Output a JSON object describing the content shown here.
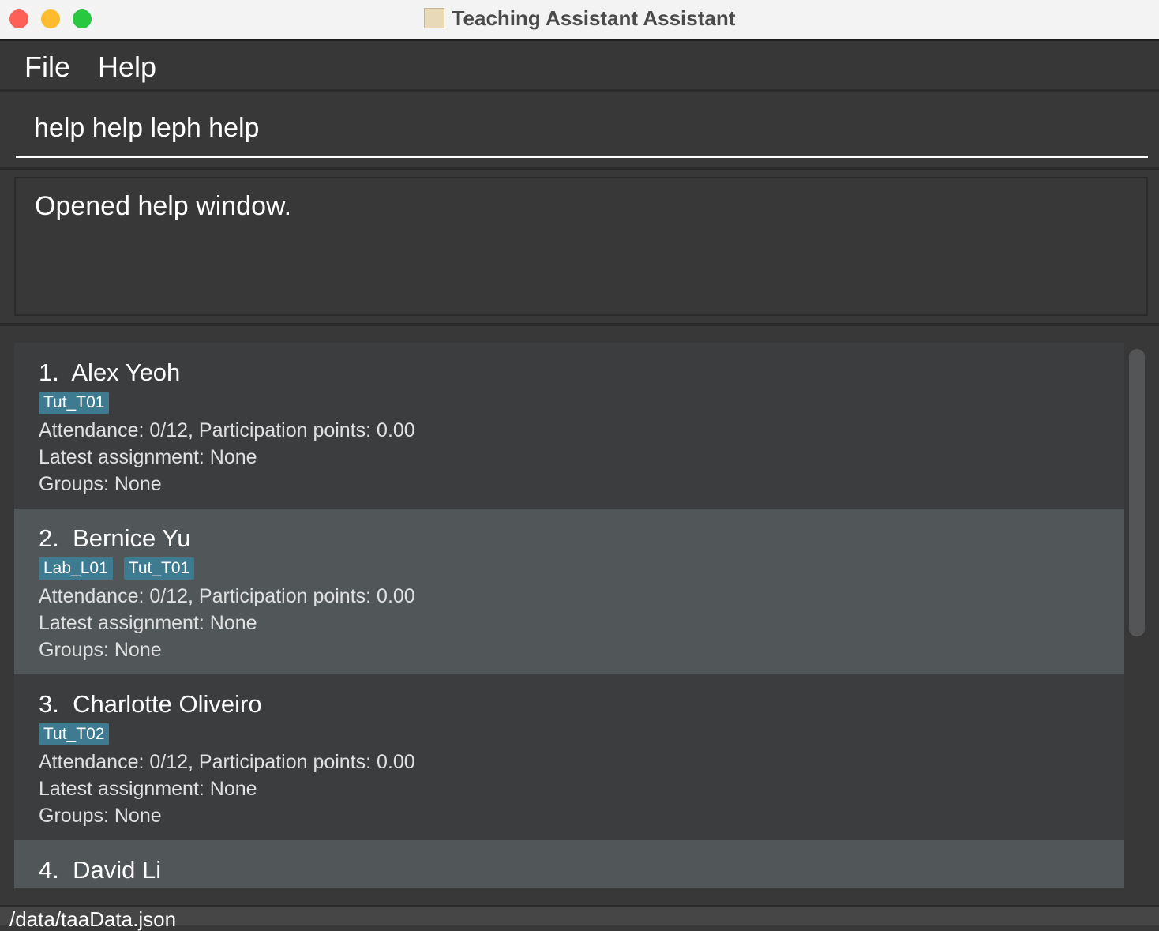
{
  "window": {
    "title": "Teaching Assistant Assistant"
  },
  "menu": {
    "file": "File",
    "help": "Help"
  },
  "command": {
    "value": "help help leph help"
  },
  "result": {
    "text": "Opened help window."
  },
  "students": [
    {
      "index": "1.",
      "name": "Alex Yeoh",
      "tags": [
        "Tut_T01"
      ],
      "attendance": "Attendance: 0/12, Participation points: 0.00",
      "assignment": "Latest assignment: None",
      "groups": "Groups: None"
    },
    {
      "index": "2.",
      "name": "Bernice Yu",
      "tags": [
        "Lab_L01",
        "Tut_T01"
      ],
      "attendance": "Attendance: 0/12, Participation points: 0.00",
      "assignment": "Latest assignment: None",
      "groups": "Groups: None"
    },
    {
      "index": "3.",
      "name": "Charlotte Oliveiro",
      "tags": [
        "Tut_T02"
      ],
      "attendance": "Attendance: 0/12, Participation points: 0.00",
      "assignment": "Latest assignment: None",
      "groups": "Groups: None"
    },
    {
      "index": "4.",
      "name": "David Li",
      "tags": [],
      "attendance": "",
      "assignment": "",
      "groups": ""
    }
  ],
  "status": {
    "path": "/data/taaData.json"
  },
  "colors": {
    "tag": "#3e7b91",
    "card_odd": "#3c3d3f",
    "card_even": "#515658"
  }
}
